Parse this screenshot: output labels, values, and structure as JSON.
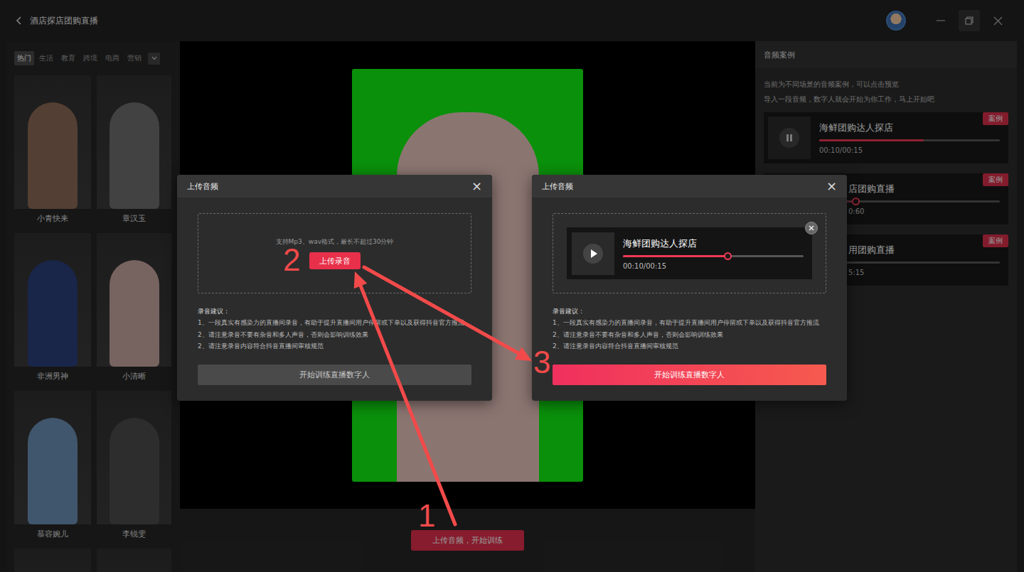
{
  "window": {
    "title": "酒店探店团购直播"
  },
  "categories": [
    {
      "label": "热门",
      "selected": true
    },
    {
      "label": "生活",
      "selected": false
    },
    {
      "label": "教育",
      "selected": false
    },
    {
      "label": "跨境",
      "selected": false
    },
    {
      "label": "电商",
      "selected": false
    },
    {
      "label": "营销",
      "selected": false
    }
  ],
  "avatars": [
    {
      "name": "小青快来"
    },
    {
      "name": "章汉玉"
    },
    {
      "name": "非洲男神"
    },
    {
      "name": "小清晰"
    },
    {
      "name": "慕容婉儿"
    },
    {
      "name": "李锐雯"
    },
    {
      "name": ""
    },
    {
      "name": ""
    }
  ],
  "preview": {
    "button": "上传音频，开始训练"
  },
  "cases": {
    "title": "音频案例",
    "description": [
      "当前为不同场景的音频案例，可以点击预览",
      "导入一段音频，数字人就会开始为你工作，马上开始吧"
    ],
    "items": [
      {
        "title": "海鲜团购达人探店",
        "time": "00:10/00:15",
        "level": 0.58,
        "playing": true,
        "badge": "案例",
        "kind": "full"
      },
      {
        "title": "店团购直播",
        "time": "0:60",
        "level": 0.2,
        "playing": false,
        "badge": "案例",
        "kind": "cut"
      },
      {
        "title": "用团购直播",
        "time": "5:15",
        "level": 0,
        "playing": false,
        "badge": "案例",
        "kind": "cut"
      }
    ]
  },
  "dialogs": [
    {
      "kind": "empty",
      "title": "上传音频",
      "close": "×",
      "hint": "支持Mp3、wav格式，最长不超过30分钟",
      "upload_button": "上传录音",
      "tips_title": "录音建议：",
      "tips": [
        "1、一段真实有感染力的直播间录音，有助于提升直播间用户停留或下单以及获得抖音官方推流",
        "2、请注意录音不要有杂音和多人声音，否则会影响训练效果",
        "2、请注意录音内容符合抖音直播间审核规范"
      ],
      "submit": {
        "label": "开始训练直播数字人",
        "disabled": true
      }
    },
    {
      "kind": "file",
      "title": "上传音频",
      "close": "×",
      "file": {
        "title": "海鲜团购达人探店",
        "time": "00:10/00:15",
        "level": 0.58
      },
      "tips_title": "录音建议：",
      "tips": [
        "1、一段真实有感染力的直播间录音，有助于提升直播间用户停留或下单以及获得抖音官方推流",
        "2、请注意录音不要有杂音和多人声音，否则会影响训练效果",
        "2、请注意录音内容符合抖音直播间审核规范"
      ],
      "submit": {
        "label": "开始训练直播数字人",
        "disabled": false
      }
    }
  ],
  "annotations": [
    {
      "label": "1",
      "color": "#f24a4a"
    },
    {
      "label": "2",
      "color": "#f24a4a"
    },
    {
      "label": "3",
      "color": "#f24a4a"
    }
  ]
}
